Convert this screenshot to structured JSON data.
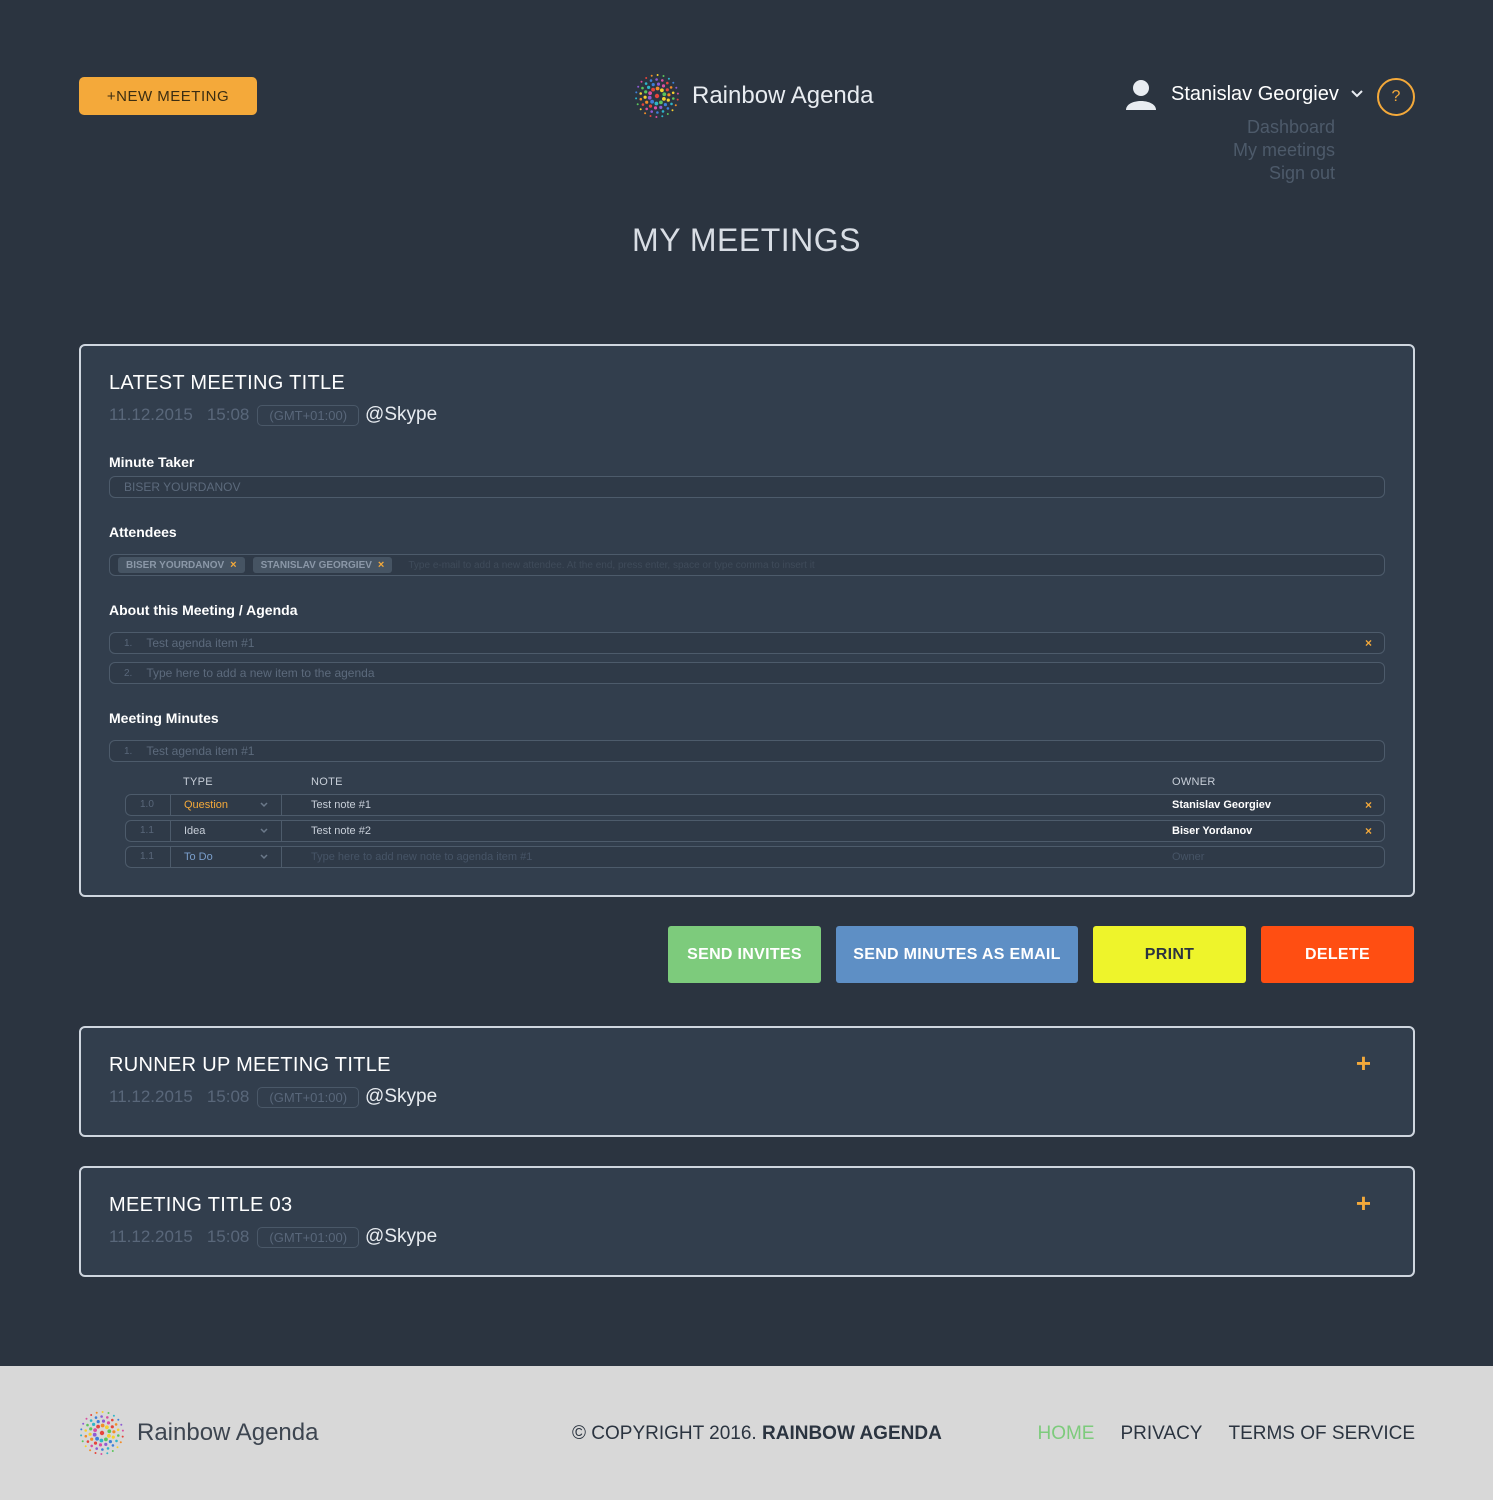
{
  "header": {
    "new_meeting_label": "+NEW MEETING",
    "brand_name": "Rainbow Agenda",
    "user_name": "Stanislav Georgiev",
    "help_label": "?",
    "menu": [
      "Dashboard",
      "My meetings",
      "Sign out"
    ]
  },
  "page_title": "MY MEETINGS",
  "latest": {
    "title": "LATEST MEETING TITLE",
    "date": "11.12.2015",
    "time": "15:08",
    "tz": "(GMT+01:00)",
    "location": "@Skype",
    "minute_taker_label": "Minute Taker",
    "minute_taker_value": "BISER YOURDANOV",
    "attendees_label": "Attendees",
    "attendees": [
      "BISER YOURDANOV",
      "STANISLAV GEORGIEV"
    ],
    "attendee_remove": "×",
    "attendees_placeholder": "Type e-mail to add a new attendee. At the end, press enter, space or type comma to insert it",
    "agenda_label": "About this Meeting / Agenda",
    "agenda_items": [
      {
        "num": "1.",
        "text": "Test agenda item #1",
        "remove": "×"
      },
      {
        "num": "2.",
        "text": "Type here to add a new item to the agenda"
      }
    ],
    "minutes_label": "Meeting Minutes",
    "minutes_item": {
      "num": "1.",
      "text": "Test agenda item #1"
    },
    "minutes_headers": {
      "type": "TYPE",
      "note": "NOTE",
      "owner": "OWNER"
    },
    "minutes_rows": [
      {
        "num": "1.0",
        "type": "Question",
        "note": "Test note #1",
        "owner": "Stanislav Georgiev",
        "remove": "×"
      },
      {
        "num": "1.1",
        "type": "Idea",
        "note": "Test note #2",
        "owner": "Biser Yordanov",
        "remove": "×"
      },
      {
        "num": "1.1",
        "type": "To Do",
        "note": "Type here to add new note to agenda item #1",
        "owner": "Owner"
      }
    ]
  },
  "actions": {
    "send_invites": "SEND INVITES",
    "send_minutes": "SEND MINUTES AS EMAIL",
    "print": "PRINT",
    "delete": "DELETE"
  },
  "collapsed_meetings": [
    {
      "title": "RUNNER UP MEETING TITLE",
      "date": "11.12.2015",
      "time": "15:08",
      "tz": "(GMT+01:00)",
      "location": "@Skype",
      "expand": "+"
    },
    {
      "title": "MEETING TITLE 03",
      "date": "11.12.2015",
      "time": "15:08",
      "tz": "(GMT+01:00)",
      "location": "@Skype",
      "expand": "+"
    }
  ],
  "footer": {
    "brand_name": "Rainbow Agenda",
    "copyright_prefix": "© COPYRIGHT 2016.",
    "copyright_brand": "RAINBOW AGENDA",
    "links": [
      "HOME",
      "PRIVACY",
      "TERMS OF SERVICE"
    ]
  },
  "colors": {
    "background": "#2b3440",
    "card": "#323e4d",
    "accent": "#f4a93a",
    "send_invites": "#7dcb7c",
    "send_minutes": "#5e8fc5",
    "print": "#eef42b",
    "delete": "#ff4e12",
    "footer_bg": "#d8d8d8",
    "footer_active": "#7dcb7c",
    "question_type": "#f4a93a",
    "idea_type": "#c7ced8",
    "todo_type": "#7a9ecb"
  }
}
